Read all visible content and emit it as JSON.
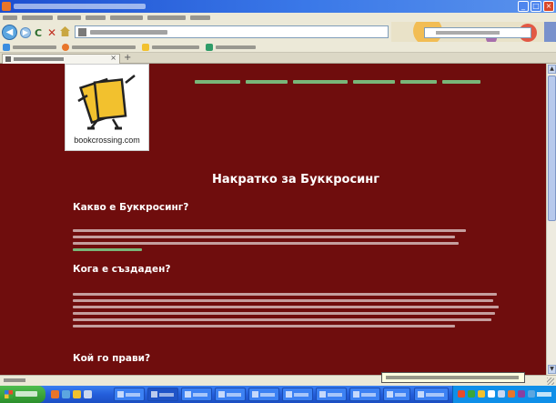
{
  "page": {
    "heading": "Накратко за Буккросинг",
    "sections": [
      {
        "title": "Какво е Буккросинг?"
      },
      {
        "title": "Кога е създаден?"
      },
      {
        "title": "Кой го прави?"
      }
    ]
  },
  "logo": {
    "text": "bookcrossing.com"
  },
  "colors": {
    "page_background": "#6f0d0d",
    "heading_text": "#ffffff",
    "link": "#79b679",
    "titlebar": "#1d4fd0",
    "taskbar": "#245edb",
    "start_button": "#3aa63a"
  },
  "icons": {
    "window_controls": [
      "minimize-icon",
      "maximize-icon",
      "close-icon"
    ],
    "toolbar": [
      "back-icon",
      "forward-icon",
      "reload-icon",
      "stop-icon",
      "home-icon"
    ],
    "scrollbar": [
      "chevron-up-icon",
      "chevron-down-icon"
    ],
    "new_tab": "plus-icon"
  },
  "glyphs": {
    "minimize": "_",
    "maximize": "□",
    "close": "×",
    "back": "◀",
    "forward": "▶",
    "reload": "C",
    "stop": "✕",
    "new_tab": "+",
    "tab_close": "×",
    "scroll_up": "▲",
    "scroll_down": "▼"
  }
}
